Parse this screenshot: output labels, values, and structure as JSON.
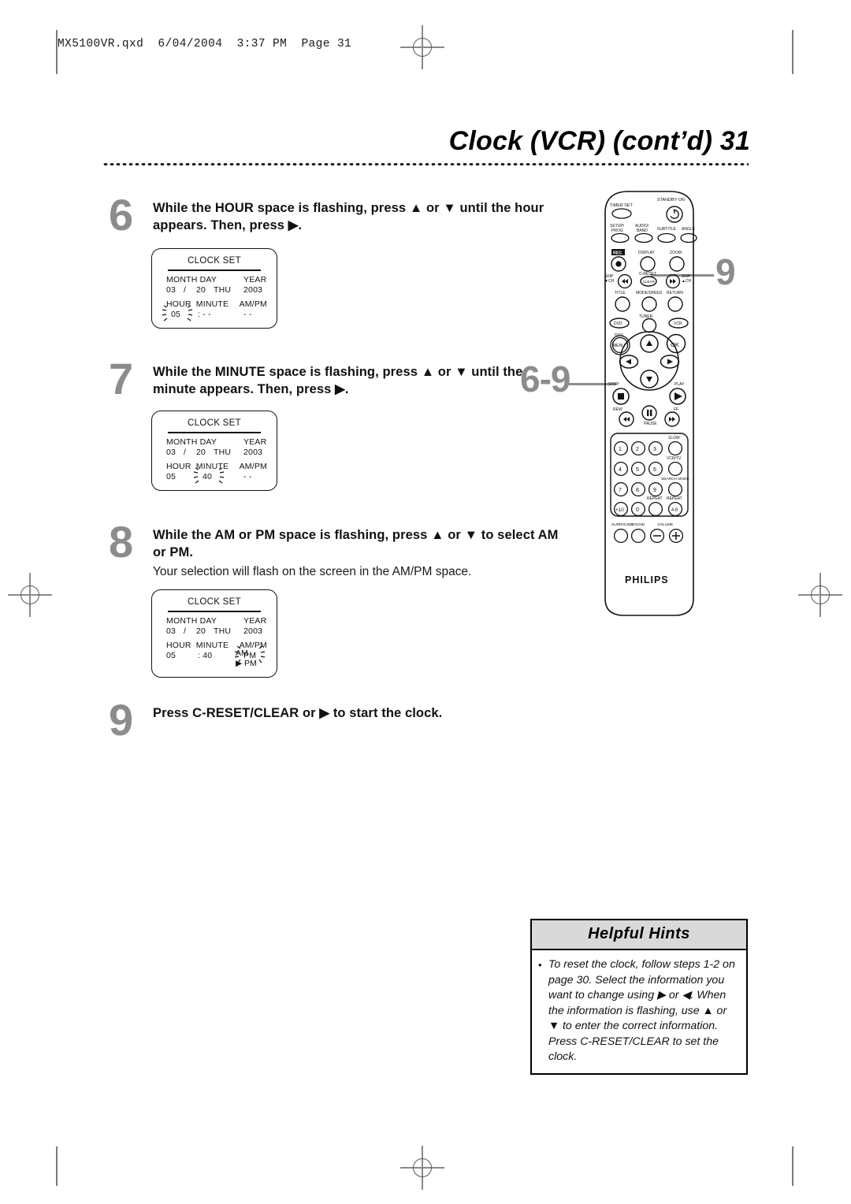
{
  "file_header": "MX5100VR.qxd  6/04/2004  3:37 PM  Page 31",
  "title": "Clock (VCR) (cont’d)  31",
  "steps": [
    {
      "number": "6",
      "lead_parts": [
        "While the HOUR space is flashing, press ",
        "▲",
        " or ",
        "▼",
        " until the hour appears. Then, press ",
        "▶",
        "."
      ],
      "lead": "While the HOUR space is flashing, press ▲ or ▼ until the hour appears. Then, press ▶.",
      "sub": ""
    },
    {
      "number": "7",
      "lead": "While the MINUTE space is flashing, press ▲ or ▼ until the minute appears. Then, press ▶.",
      "sub": ""
    },
    {
      "number": "8",
      "lead": "While the AM or PM space is flashing, press ▲ or ▼ to select  AM or PM.",
      "sub": "Your selection will flash on the screen in the AM/PM space."
    },
    {
      "number": "9",
      "lead": "Press C-RESET/CLEAR or ▶ to start the clock.",
      "sub": ""
    }
  ],
  "osd": {
    "title": "CLOCK SET",
    "labels_row1": {
      "month_day": "MONTH DAY",
      "year": "YEAR"
    },
    "labels_row2": {
      "hour": "HOUR",
      "minute": "MINUTE",
      "ampm": "AM/PM"
    },
    "screens": [
      {
        "month": "03",
        "slash": "/",
        "day": "20",
        "weekday": "THU",
        "year": "2003",
        "hour": "05",
        "hour_flashing": true,
        "colon": ":",
        "minute": "- -",
        "minute_flashing": false,
        "ampm": "- -",
        "ampm_flashing": false,
        "ampm_options": []
      },
      {
        "month": "03",
        "slash": "/",
        "day": "20",
        "weekday": "THU",
        "year": "2003",
        "hour": "05",
        "hour_flashing": false,
        "colon": "",
        "minute": "40",
        "minute_flashing": true,
        "ampm": "- -",
        "ampm_flashing": false,
        "ampm_options": []
      },
      {
        "month": "03",
        "slash": "/",
        "day": "20",
        "weekday": "THU",
        "year": "2003",
        "hour": "05",
        "hour_flashing": false,
        "colon": ":",
        "minute": "40",
        "minute_flashing": false,
        "ampm": "PM",
        "ampm_flashing": true,
        "ampm_options": [
          "AM",
          "▶ PM"
        ]
      }
    ]
  },
  "callouts": [
    {
      "label": "9",
      "target": "c-reset-clear-button"
    },
    {
      "label": "6-9",
      "target": "navigation-pad"
    }
  ],
  "remote": {
    "brand": "PHILIPS",
    "buttons": {
      "timer_set": "TIMER SET",
      "standby_on": "STANDBY·ON",
      "setup_prog": [
        "SETUP/",
        "PROG"
      ],
      "audio_band": [
        "AUDIO/",
        "BAND"
      ],
      "subtitle": "SUBTITLE",
      "angle": "ANGLE",
      "rec": "REC",
      "display": "DISPLAY",
      "zoom": "ZOOM",
      "skip_down": [
        "SKIP",
        "▼CH"
      ],
      "c_reset": "C-RESET",
      "clear": "CLEAR",
      "skip_up": [
        "SKIP",
        "▲CH"
      ],
      "title": "TITLE",
      "mode_speed": "MODE/SPEED",
      "return": "RETURN",
      "dvd": "DVD",
      "tuner": "TUNER",
      "vcr": "VCR",
      "disc": "DISC",
      "menu": "MENU",
      "ok": "OK",
      "stop": "STOP",
      "play": "PLAY",
      "rew": "REW",
      "pause": "PAUSE",
      "ff": "FF",
      "slow": "SLOW",
      "vcr_tv": "VCR/TV",
      "search_mode": "SEARCH MODE",
      "repeat": "REPEAT",
      "repeat_ab": "REPEAT",
      "repeat_ab_glyph": "A-B",
      "surround": "SURROUND",
      "sound": "SOUND",
      "volume": "VOLUME",
      "numbers": [
        "1",
        "2",
        "3",
        "4",
        "5",
        "6",
        "7",
        "8",
        "9",
        "+10",
        "0"
      ],
      "vol_minus": "−",
      "vol_plus": "+"
    }
  },
  "hints": {
    "heading": "Helpful Hints",
    "bullet": "•",
    "text": "To reset the clock, follow steps 1-2 on page 30. Select the information you want to change using ▶ or ◀. When the information is flashing, use ▲ or ▼ to enter the correct information. Press C-RESET/CLEAR to set the clock."
  }
}
